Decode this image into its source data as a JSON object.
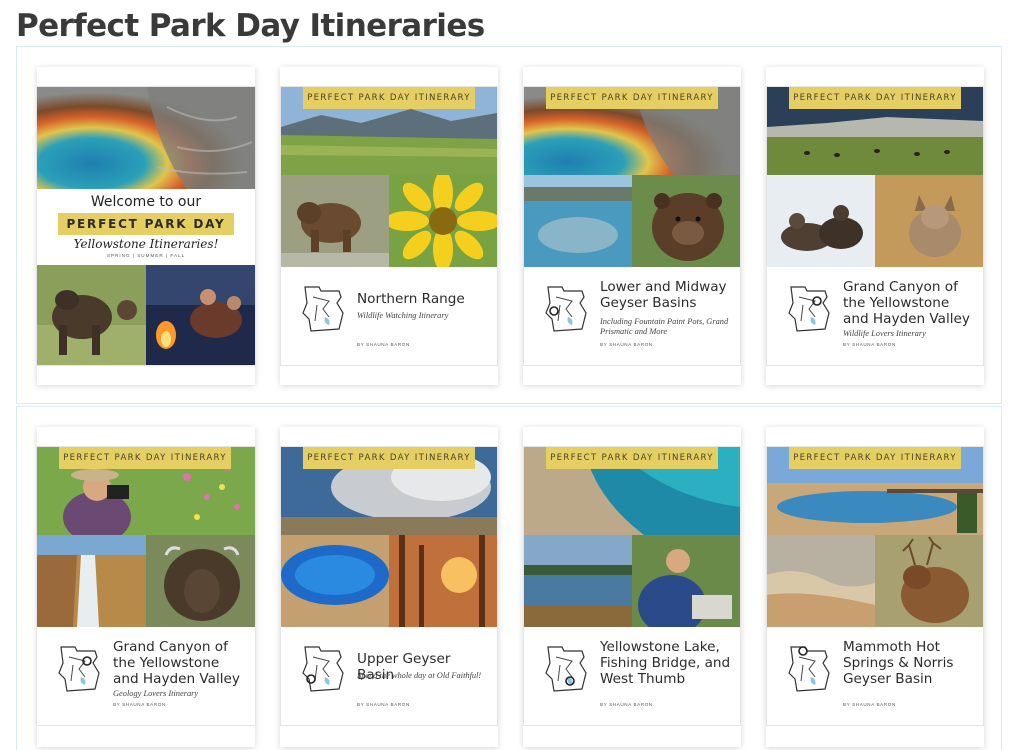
{
  "page": {
    "title": "Perfect Park Day Itineraries"
  },
  "banner_label": "PERFECT PARK DAY ITINERARY",
  "welcome": {
    "line1": "Welcome to our",
    "highlight": "PERFECT PARK DAY",
    "line3": "Yellowstone Itineraries!",
    "seasons": "SPRING | SUMMER | FALL"
  },
  "cards": [
    {
      "title": "Northern Range",
      "subtitle": "Wildlife Watching Itinerary",
      "byline": "BY SHAUNA BARON"
    },
    {
      "title": "Lower and Midway Geyser Basins",
      "subtitle": "Including Fountain Paint Pots, Grand Prismatic and More",
      "byline": "BY SHAUNA BARON"
    },
    {
      "title": "Grand Canyon of the Yellowstone and Hayden Valley",
      "subtitle": "Wildlife Lovers Itinerary",
      "byline": "BY SHAUNA BARON"
    },
    {
      "title": "Grand Canyon of the Yellowstone and Hayden Valley",
      "subtitle": "Geology Lovers Itinerary",
      "byline": "BY SHAUNA BARON"
    },
    {
      "title": "Upper Geyser Basin",
      "subtitle": "Spend the whole day at Old Faithful!",
      "byline": "BY SHAUNA BARON"
    },
    {
      "title": "Yellowstone Lake, Fishing Bridge, and West Thumb",
      "subtitle": "",
      "byline": "BY SHAUNA BARON"
    },
    {
      "title": "Mammoth Hot Springs & Norris Geyser Basin",
      "subtitle": "",
      "byline": "BY SHAUNA BARON"
    }
  ],
  "colors": {
    "banner": "#e6cf62",
    "section_border": "#d9ecf6"
  }
}
